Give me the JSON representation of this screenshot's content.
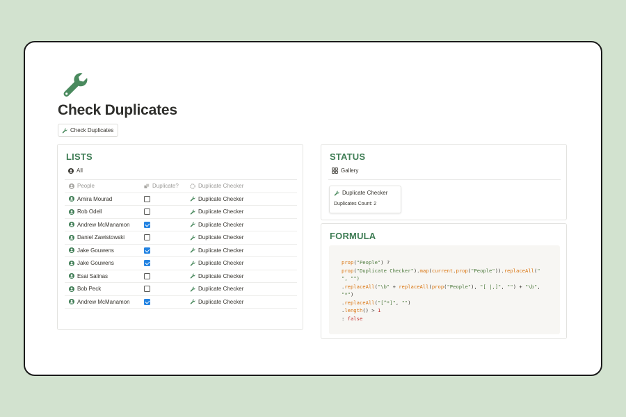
{
  "page": {
    "title": "Check Duplicates",
    "icon": "wrench-icon",
    "button_label": "Check Duplicates"
  },
  "colors": {
    "background": "#d2e2cf",
    "accent_green": "#3f7d55",
    "checkbox_blue": "#2383e2"
  },
  "lists": {
    "heading": "LISTS",
    "view_label": "All",
    "columns": {
      "people": "People",
      "duplicate": "Duplicate?",
      "checker": "Duplicate Checker"
    },
    "rows": [
      {
        "person": "Amira Mourad",
        "duplicate": false,
        "checker": "Duplicate Checker"
      },
      {
        "person": "Rob Odell",
        "duplicate": false,
        "checker": "Duplicate Checker"
      },
      {
        "person": "Andrew McManamon",
        "duplicate": true,
        "checker": "Duplicate Checker"
      },
      {
        "person": "Daniel Zawistowski",
        "duplicate": false,
        "checker": "Duplicate Checker"
      },
      {
        "person": "Jake Gouwens",
        "duplicate": true,
        "checker": "Duplicate Checker"
      },
      {
        "person": "Jake Gouwens",
        "duplicate": true,
        "checker": "Duplicate Checker"
      },
      {
        "person": "Esai Salinas",
        "duplicate": false,
        "checker": "Duplicate Checker"
      },
      {
        "person": "Bob Peck",
        "duplicate": false,
        "checker": "Duplicate Checker"
      },
      {
        "person": "Andrew McManamon",
        "duplicate": true,
        "checker": "Duplicate Checker"
      }
    ]
  },
  "status": {
    "heading": "STATUS",
    "view_label": "Gallery",
    "card": {
      "title": "Duplicate Checker",
      "property": "Duplicates Count: 2"
    }
  },
  "formula": {
    "heading": "FORMULA",
    "code_lines": [
      "prop(\"People\") ?",
      "prop(\"Duplicate Checker\").map(current.prop(\"People\")).replaceAll(\"",
      "\", \"\")",
      ".replaceAll(\"\\b\" + replaceAll(prop(\"People\"), \"[ |,]\", \"\") + \"\\b\",",
      "\"*\")",
      ".replaceAll(\"[^*]\", \"\")",
      ".length() > 1",
      ": false"
    ]
  }
}
